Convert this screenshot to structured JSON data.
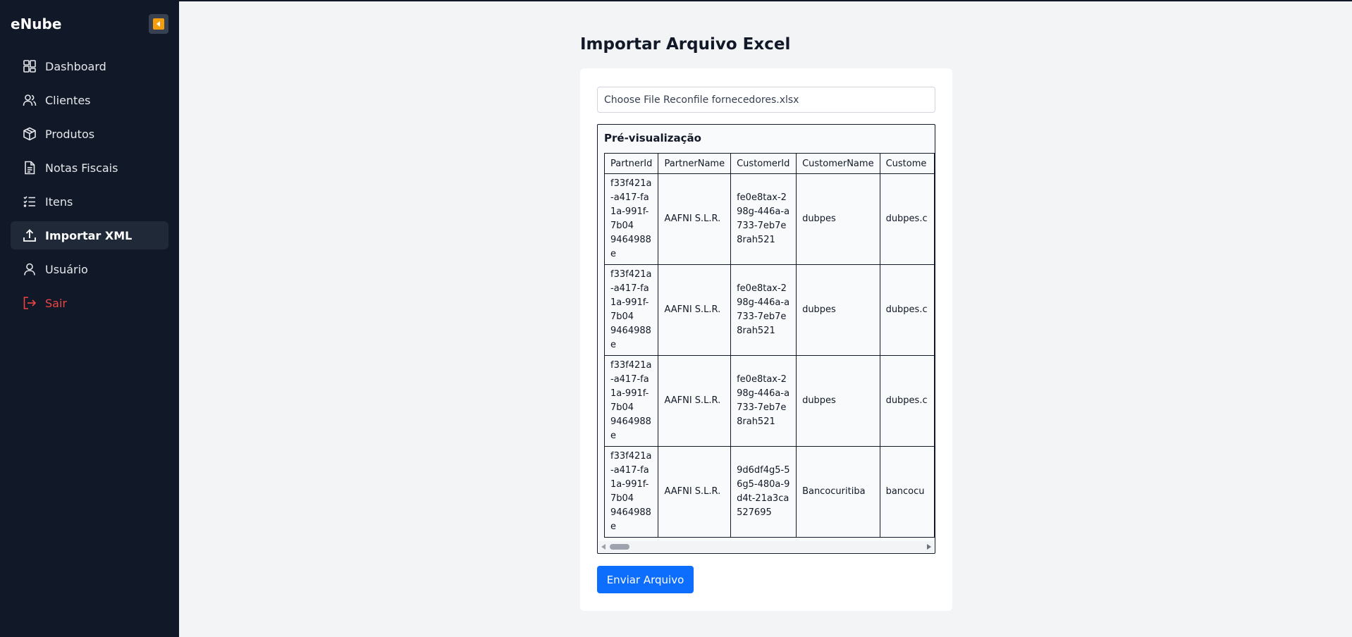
{
  "app": {
    "brand": "eNube"
  },
  "colors": {
    "sidebar_bg": "#111827",
    "accent": "#0d6efd",
    "danger": "#ef4444",
    "collapse_accent": "#f59e0b"
  },
  "sidebar": {
    "collapse_icon": "chevron-left-icon",
    "items": [
      {
        "label": "Dashboard",
        "icon": "dashboard-icon"
      },
      {
        "label": "Clientes",
        "icon": "users-icon"
      },
      {
        "label": "Produtos",
        "icon": "package-icon"
      },
      {
        "label": "Notas Fiscais",
        "icon": "document-icon"
      },
      {
        "label": "Itens",
        "icon": "list-icon"
      },
      {
        "label": "Importar XML",
        "icon": "upload-icon",
        "active": true
      },
      {
        "label": "Usuário",
        "icon": "user-icon"
      },
      {
        "label": "Sair",
        "icon": "logout-icon"
      }
    ]
  },
  "main": {
    "title": "Importar Arquivo Excel",
    "file_input": {
      "value": "Choose File Reconfile fornecedores.xlsx"
    },
    "preview": {
      "title": "Pré-visualização",
      "columns": [
        "PartnerId",
        "PartnerName",
        "CustomerId",
        "CustomerName",
        "Custome"
      ],
      "rows": [
        [
          "f33f421a-a417-fa1a-991f-7b04\n9464988e",
          "AAFNI S.L.R.",
          "fe0e8tax-298g-446a-a733-7eb7e8rah521",
          "dubpes",
          "dubpes.c"
        ],
        [
          "f33f421a-a417-fa1a-991f-7b04\n9464988e",
          "AAFNI S.L.R.",
          "fe0e8tax-298g-446a-a733-7eb7e8rah521",
          "dubpes",
          "dubpes.c"
        ],
        [
          "f33f421a-a417-fa1a-991f-7b04\n9464988e",
          "AAFNI S.L.R.",
          "fe0e8tax-298g-446a-a733-7eb7e8rah521",
          "dubpes",
          "dubpes.c"
        ],
        [
          "f33f421a-a417-fa1a-991f-7b04\n9464988e",
          "AAFNI S.L.R.",
          "9d6df4g5-56g5-480a-9d4t-21a3ca527695",
          "Bancocuritiba",
          "bancocu"
        ]
      ]
    },
    "submit_label": "Enviar Arquivo"
  }
}
